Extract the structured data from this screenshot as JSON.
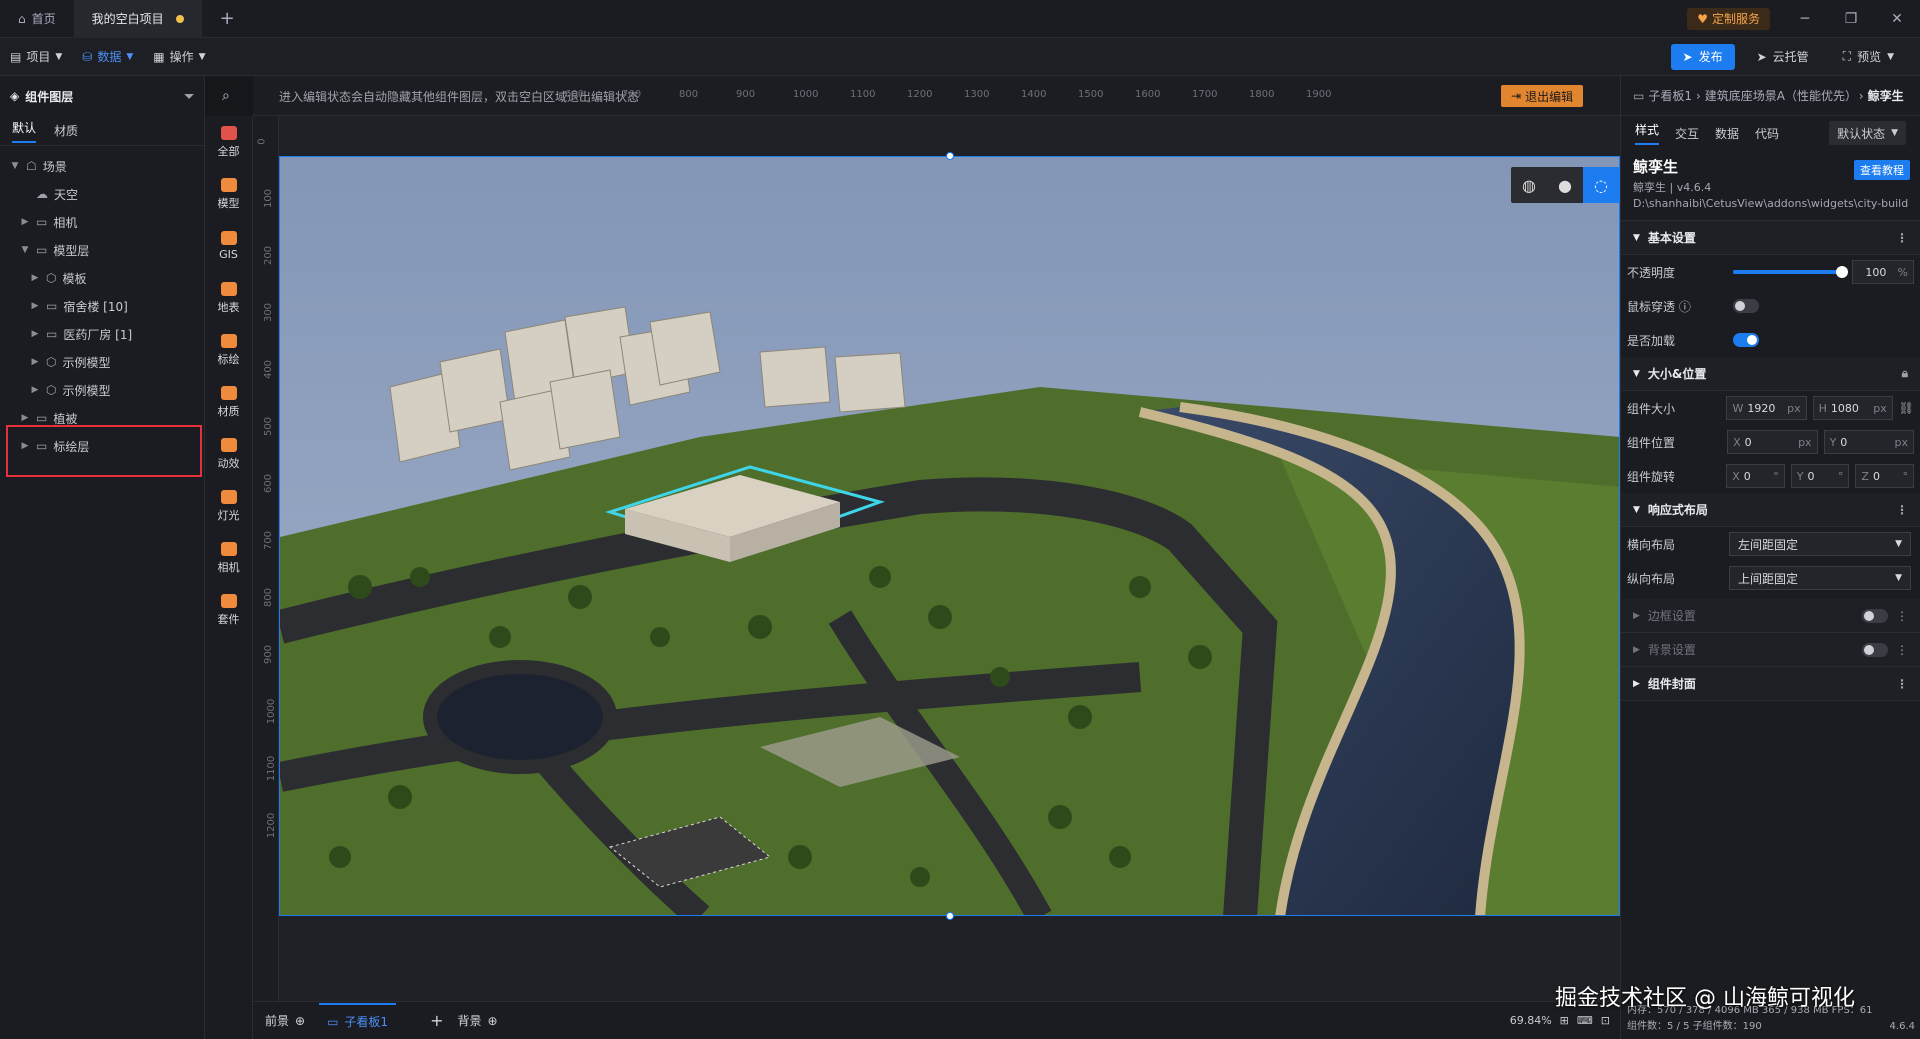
{
  "titlebar": {
    "tabs": [
      {
        "label": "首页"
      },
      {
        "label": "我的空白项目"
      }
    ],
    "custom_service": "定制服务",
    "controls": {
      "minimize": "─",
      "restore": "❐",
      "close": "✕"
    }
  },
  "menubar": {
    "items": [
      {
        "label": "项目"
      },
      {
        "label": "数据"
      },
      {
        "label": "操作"
      }
    ],
    "publish": "发布",
    "cloud": "云托管",
    "preview": "预览"
  },
  "left_panel": {
    "title": "组件图层",
    "tabs": [
      "默认",
      "材质"
    ],
    "tree": [
      {
        "label": "场景",
        "level": 0,
        "caret": "▼",
        "icon": "scene"
      },
      {
        "label": "天空",
        "level": 1,
        "caret": "",
        "icon": "sky"
      },
      {
        "label": "相机",
        "level": 1,
        "caret": "▶",
        "icon": "folder"
      },
      {
        "label": "模型层",
        "level": 1,
        "caret": "▼",
        "icon": "folder"
      },
      {
        "label": "模板",
        "level": 2,
        "caret": "▶",
        "icon": "cube"
      },
      {
        "label": "宿舍楼 [10]",
        "level": 2,
        "caret": "▶",
        "icon": "folder"
      },
      {
        "label": "医药厂房 [1]",
        "level": 2,
        "caret": "▶",
        "icon": "folder"
      },
      {
        "label": "示例模型",
        "level": 2,
        "caret": "▶",
        "icon": "cube"
      },
      {
        "label": "示例模型",
        "level": 2,
        "caret": "▶",
        "icon": "cube"
      },
      {
        "label": "植被",
        "level": 1,
        "caret": "▶",
        "icon": "folder"
      },
      {
        "label": "标绘层",
        "level": 1,
        "caret": "▶",
        "icon": "folder"
      }
    ]
  },
  "icon_bar": [
    {
      "label": "全部",
      "color": "#e0524a"
    },
    {
      "label": "模型",
      "color": "#f08a3c"
    },
    {
      "label": "GIS",
      "color": "#f08a3c"
    },
    {
      "label": "地表",
      "color": "#f08a3c"
    },
    {
      "label": "标绘",
      "color": "#f08a3c"
    },
    {
      "label": "材质",
      "color": "#f08a3c"
    },
    {
      "label": "动效",
      "color": "#f08a3c"
    },
    {
      "label": "灯光",
      "color": "#f08a3c"
    },
    {
      "label": "相机",
      "color": "#f08a3c"
    },
    {
      "label": "套件",
      "color": "#f08a3c"
    }
  ],
  "canvas": {
    "hint": "进入编辑状态会自动隐藏其他组件图层，双击空白区域退出编辑状态",
    "exit": "退出编辑",
    "hruler": [
      "600",
      "700",
      "800",
      "900",
      "1000",
      "1100",
      "1200",
      "1300",
      "1400",
      "1500",
      "1600",
      "1700",
      "1800",
      "1900"
    ],
    "vruler": [
      "0",
      "100",
      "200",
      "300",
      "400",
      "500",
      "600",
      "700",
      "800",
      "900",
      "1000",
      "1100",
      "1200"
    ]
  },
  "bottom": {
    "tabs": [
      "前景",
      "子看板1",
      "背景"
    ],
    "zoom": "69.84%"
  },
  "right_panel": {
    "breadcrumb": [
      "子看板1",
      "建筑底座场景A（性能优先）",
      "鲸孪生"
    ],
    "tabs": [
      "样式",
      "交互",
      "数据",
      "代码"
    ],
    "state": "默认状态",
    "component": {
      "name": "鲸孪生",
      "version": "鲸孪生 | v4.6.4",
      "path": "D:\\shanhaibi\\CetusView\\addons\\widgets\\city-builder",
      "tutorial": "查看教程"
    },
    "sections": {
      "basic": "基本设置",
      "size_pos": "大小&位置",
      "responsive": "响应式布局",
      "border": "边框设置",
      "background": "背景设置",
      "cover": "组件封面"
    },
    "props": {
      "opacity_label": "不透明度",
      "opacity": "100",
      "opacity_unit": "%",
      "opacity_value": 1.0,
      "mouse_through": "鼠标穿透",
      "load": "是否加载",
      "size_label": "组件大小",
      "w": "1920",
      "h": "1080",
      "pos_label": "组件位置",
      "x": "0",
      "y": "0",
      "rot_label": "组件旋转",
      "rx": "0",
      "ry": "0",
      "rz": "0",
      "hlayout_label": "横向布局",
      "hlayout": "左间距固定",
      "vlayout_label": "纵向布局",
      "vlayout": "上间距固定"
    },
    "status": {
      "line1": "内存：570 / 378 / 4096 MB   365 / 938 MB   FPS：61",
      "line2": "组件数：5 / 5   子组件数：190",
      "version": "4.6.4"
    }
  },
  "watermark": "掘金技术社区 @ 山海鲸可视化"
}
